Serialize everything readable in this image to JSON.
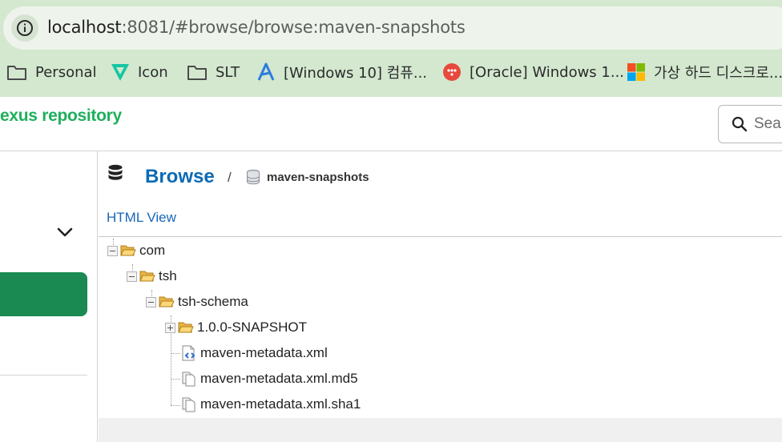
{
  "browser": {
    "url_host": "localhost",
    "url_path": ":8081/#browse/browse:maven-snapshots",
    "bookmarks": [
      {
        "label": "Personal",
        "icon": "folder-icon"
      },
      {
        "label": "Icon",
        "icon": "v-logo-icon"
      },
      {
        "label": "SLT",
        "icon": "folder-icon"
      },
      {
        "label": "[Windows 10] 컴퓨...",
        "icon": "blue-a-logo-icon"
      },
      {
        "label": "[Oracle] Windows 1...",
        "icon": "red-circle-logo-icon"
      },
      {
        "label": "가상 하드 디스크로...",
        "icon": "microsoft-logo-icon"
      }
    ]
  },
  "app": {
    "logo": "exus repository",
    "search_placeholder": "Search"
  },
  "browse": {
    "title": "Browse",
    "separator": "/",
    "repository": "maven-snapshots",
    "html_view": "HTML View"
  },
  "tree": [
    {
      "label": "com",
      "type": "folder-open",
      "expander": "minus"
    },
    {
      "label": "tsh",
      "type": "folder-open",
      "expander": "minus"
    },
    {
      "label": "tsh-schema",
      "type": "folder-open",
      "expander": "minus"
    },
    {
      "label": "1.0.0-SNAPSHOT",
      "type": "folder-open",
      "expander": "plus"
    },
    {
      "label": "maven-metadata.xml",
      "type": "xml-file"
    },
    {
      "label": "maven-metadata.xml.md5",
      "type": "file"
    },
    {
      "label": "maven-metadata.xml.sha1",
      "type": "file"
    }
  ],
  "colors": {
    "chrome_bg": "#d3e8cf",
    "brand_green": "#1faf5c",
    "sidebar_active": "#1a8a52",
    "link_blue": "#1967b8",
    "title_blue": "#0b6bb5"
  }
}
